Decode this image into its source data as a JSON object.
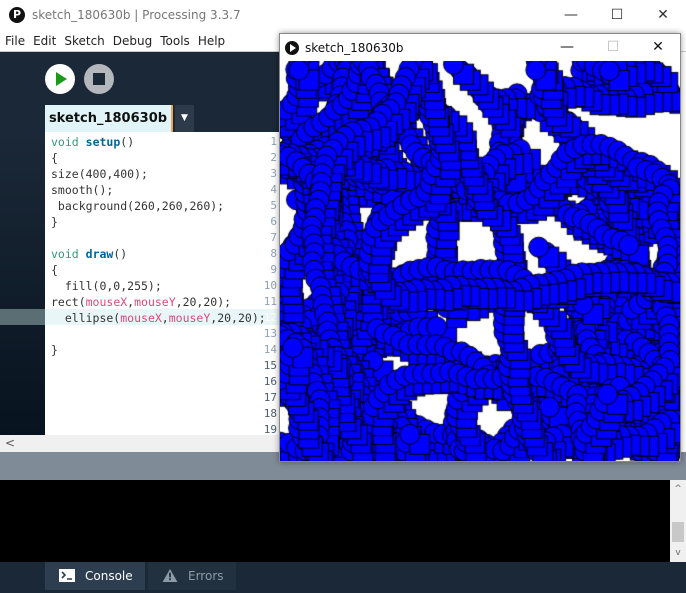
{
  "window": {
    "title": "sketch_180630b | Processing 3.3.7",
    "logo": "P3",
    "minimize": "—",
    "maximize": "☐",
    "close": "✕"
  },
  "menu": [
    "File",
    "Edit",
    "Sketch",
    "Debug",
    "Tools",
    "Help"
  ],
  "editor": {
    "tab": "sketch_180630b",
    "tab_menu": "▼",
    "current_line": 12,
    "line_numbers": [
      "1",
      "2",
      "3",
      "4",
      "5",
      "6",
      "7",
      "8",
      "9",
      "10",
      "11",
      "12",
      "13",
      "14",
      "15",
      "16",
      "17",
      "18",
      "19"
    ],
    "lines": [
      "void setup()",
      "{",
      "size(400,400);",
      "smooth();",
      " background(260,260,260);",
      "}",
      "",
      "void draw()",
      "{",
      "  fill(0,0,255);",
      "rect(mouseX,mouseY,20,20);",
      "  ellipse(mouseX,mouseY,20,20);",
      "",
      "}"
    ]
  },
  "scroll_left": "<",
  "console": {
    "scroll_up": "^",
    "scroll_down": "v"
  },
  "footer": {
    "console": "Console",
    "errors": "Errors"
  },
  "sketch_window": {
    "title": "sketch_180630b",
    "minimize": "—",
    "maximize": "☐",
    "close": "✕",
    "fill": "#0000ff",
    "background": "#ffffff"
  }
}
